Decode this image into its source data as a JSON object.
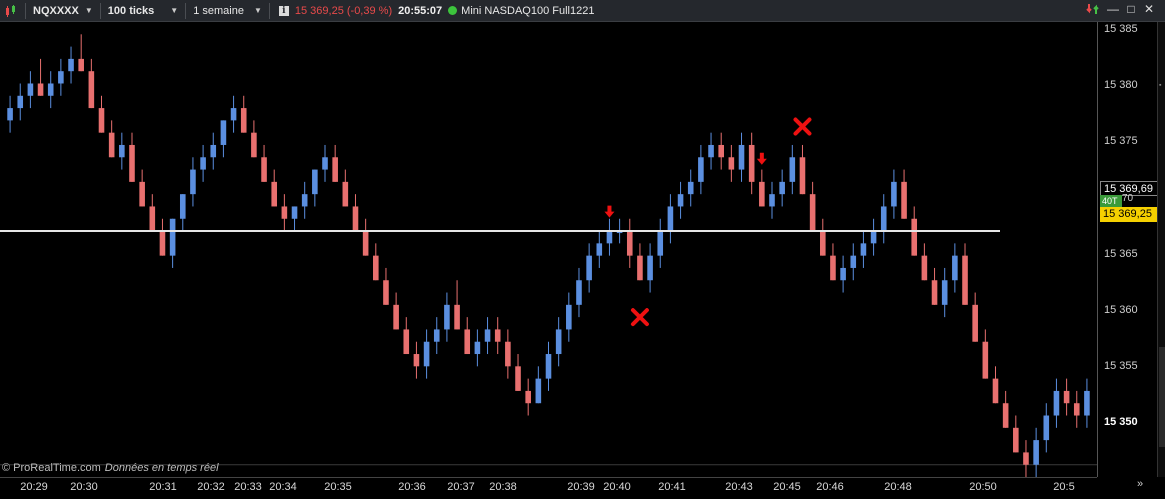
{
  "toolbar": {
    "symbol": "NQXXXX",
    "interval": "100 ticks",
    "period": "1 semaine",
    "info_icon": "i",
    "price": "15 369,25 (-0,39 %)",
    "time": "20:55:07",
    "instrument": "Mini NASDAQ100 Full1221"
  },
  "window_controls": {
    "minimize": "—",
    "maximize": "□",
    "close": "✕"
  },
  "axis": {
    "price_labels": [
      "15 385",
      "15 380",
      "15 375",
      "15 365",
      "15 360",
      "15 355",
      "15 350"
    ],
    "current_price_white": "15 369,69",
    "badge": "40T",
    "badge_partial": "70",
    "current_price_yellow": "15 369,25"
  },
  "time_labels": [
    "20:29",
    "20:30",
    "20:31",
    "20:32",
    "20:33",
    "20:34",
    "20:35",
    "20:36",
    "20:37",
    "20:38",
    "20:39",
    "20:40",
    "20:41",
    "20:43",
    "20:45",
    "20:46",
    "20:48",
    "20:50",
    "20:5"
  ],
  "watermark": {
    "brand": "© ProRealTime.com",
    "note": "Données en temps réel"
  },
  "nav": {
    "next": "»"
  },
  "colors": {
    "up": "#5b8fe0",
    "down": "#e8706f",
    "hline": "#e6e6e6",
    "marker": "#ee1111"
  },
  "chart_data": {
    "type": "candlestick",
    "ylim": [
      15349,
      15386
    ],
    "horizontal_line": 15369.0,
    "candles": [
      [
        15378,
        15380,
        15377,
        15379
      ],
      [
        15379,
        15381,
        15378,
        15380
      ],
      [
        15380,
        15382,
        15379,
        15381
      ],
      [
        15381,
        15383,
        15380,
        15380
      ],
      [
        15380,
        15382,
        15379,
        15381
      ],
      [
        15381,
        15383,
        15380,
        15382
      ],
      [
        15382,
        15384,
        15381,
        15383
      ],
      [
        15383,
        15385,
        15382,
        15382
      ],
      [
        15382,
        15383,
        15379,
        15379
      ],
      [
        15379,
        15380,
        15377,
        15377
      ],
      [
        15377,
        15378,
        15375,
        15375
      ],
      [
        15375,
        15377,
        15374,
        15376
      ],
      [
        15376,
        15377,
        15373,
        15373
      ],
      [
        15373,
        15374,
        15371,
        15371
      ],
      [
        15371,
        15372,
        15369,
        15369
      ],
      [
        15369,
        15370,
        15367,
        15367
      ],
      [
        15367,
        15370,
        15366,
        15370
      ],
      [
        15370,
        15372,
        15369,
        15372
      ],
      [
        15372,
        15375,
        15371,
        15374
      ],
      [
        15374,
        15376,
        15373,
        15375
      ],
      [
        15375,
        15377,
        15374,
        15376
      ],
      [
        15376,
        15378,
        15375,
        15378
      ],
      [
        15378,
        15380,
        15377,
        15379
      ],
      [
        15379,
        15380,
        15377,
        15377
      ],
      [
        15377,
        15378,
        15375,
        15375
      ],
      [
        15375,
        15376,
        15373,
        15373
      ],
      [
        15373,
        15374,
        15371,
        15371
      ],
      [
        15371,
        15372,
        15369,
        15370
      ],
      [
        15370,
        15371,
        15369,
        15371
      ],
      [
        15371,
        15373,
        15370,
        15372
      ],
      [
        15372,
        15374,
        15371,
        15374
      ],
      [
        15374,
        15376,
        15373,
        15375
      ],
      [
        15375,
        15376,
        15373,
        15373
      ],
      [
        15373,
        15374,
        15371,
        15371
      ],
      [
        15371,
        15372,
        15369,
        15369
      ],
      [
        15369,
        15370,
        15367,
        15367
      ],
      [
        15367,
        15368,
        15365,
        15365
      ],
      [
        15365,
        15366,
        15363,
        15363
      ],
      [
        15363,
        15364,
        15361,
        15361
      ],
      [
        15361,
        15362,
        15359,
        15359
      ],
      [
        15359,
        15360,
        15357,
        15358
      ],
      [
        15358,
        15361,
        15357,
        15360
      ],
      [
        15360,
        15362,
        15359,
        15361
      ],
      [
        15361,
        15364,
        15360,
        15363
      ],
      [
        15363,
        15365,
        15361,
        15361
      ],
      [
        15361,
        15362,
        15359,
        15359
      ],
      [
        15359,
        15361,
        15358,
        15360
      ],
      [
        15360,
        15362,
        15359,
        15361
      ],
      [
        15361,
        15362,
        15359,
        15360
      ],
      [
        15360,
        15361,
        15357,
        15358
      ],
      [
        15358,
        15359,
        15356,
        15356
      ],
      [
        15356,
        15357,
        15354,
        15355
      ],
      [
        15355,
        15358,
        15355,
        15357
      ],
      [
        15357,
        15360,
        15356,
        15359
      ],
      [
        15359,
        15362,
        15358,
        15361
      ],
      [
        15361,
        15364,
        15360,
        15363
      ],
      [
        15363,
        15366,
        15362,
        15365
      ],
      [
        15365,
        15368,
        15364,
        15367
      ],
      [
        15367,
        15369,
        15366,
        15368
      ],
      [
        15368,
        15370,
        15367,
        15369
      ],
      [
        15369,
        15370,
        15368,
        15369
      ],
      [
        15369,
        15370,
        15366,
        15367
      ],
      [
        15367,
        15368,
        15365,
        15365
      ],
      [
        15365,
        15368,
        15364,
        15367
      ],
      [
        15367,
        15370,
        15366,
        15369
      ],
      [
        15369,
        15372,
        15368,
        15371
      ],
      [
        15371,
        15373,
        15370,
        15372
      ],
      [
        15372,
        15374,
        15371,
        15373
      ],
      [
        15373,
        15376,
        15372,
        15375
      ],
      [
        15375,
        15377,
        15374,
        15376
      ],
      [
        15376,
        15377,
        15374,
        15375
      ],
      [
        15375,
        15376,
        15373,
        15374
      ],
      [
        15374,
        15377,
        15373,
        15376
      ],
      [
        15376,
        15377,
        15372,
        15373
      ],
      [
        15373,
        15374,
        15371,
        15371
      ],
      [
        15371,
        15373,
        15370,
        15372
      ],
      [
        15372,
        15374,
        15371,
        15373
      ],
      [
        15373,
        15376,
        15372,
        15375
      ],
      [
        15375,
        15376,
        15372,
        15372
      ],
      [
        15372,
        15373,
        15369,
        15369
      ],
      [
        15369,
        15370,
        15367,
        15367
      ],
      [
        15367,
        15368,
        15365,
        15365
      ],
      [
        15365,
        15367,
        15364,
        15366
      ],
      [
        15366,
        15368,
        15365,
        15367
      ],
      [
        15367,
        15369,
        15366,
        15368
      ],
      [
        15368,
        15370,
        15367,
        15369
      ],
      [
        15369,
        15372,
        15368,
        15371
      ],
      [
        15371,
        15374,
        15370,
        15373
      ],
      [
        15373,
        15374,
        15370,
        15370
      ],
      [
        15370,
        15371,
        15367,
        15367
      ],
      [
        15367,
        15368,
        15365,
        15365
      ],
      [
        15365,
        15366,
        15363,
        15363
      ],
      [
        15363,
        15366,
        15362,
        15365
      ],
      [
        15365,
        15368,
        15364,
        15367
      ],
      [
        15367,
        15368,
        15363,
        15363
      ],
      [
        15363,
        15364,
        15360,
        15360
      ],
      [
        15360,
        15361,
        15357,
        15357
      ],
      [
        15357,
        15358,
        15355,
        15355
      ],
      [
        15355,
        15356,
        15353,
        15353
      ],
      [
        15353,
        15354,
        15351,
        15351
      ],
      [
        15351,
        15352,
        15349,
        15350
      ],
      [
        15350,
        15353,
        15349,
        15352
      ],
      [
        15352,
        15355,
        15351,
        15354
      ],
      [
        15354,
        15357,
        15353,
        15356
      ],
      [
        15356,
        15357,
        15354,
        15355
      ],
      [
        15355,
        15356,
        15353,
        15354
      ],
      [
        15354,
        15357,
        15353,
        15356
      ]
    ],
    "markers": [
      {
        "type": "arrow-down",
        "index": 59,
        "price": 15370.5
      },
      {
        "type": "cross",
        "index": 62,
        "price": 15362
      },
      {
        "type": "arrow-down",
        "index": 74,
        "price": 15374.8
      },
      {
        "type": "cross",
        "index": 78,
        "price": 15377.5
      }
    ]
  }
}
